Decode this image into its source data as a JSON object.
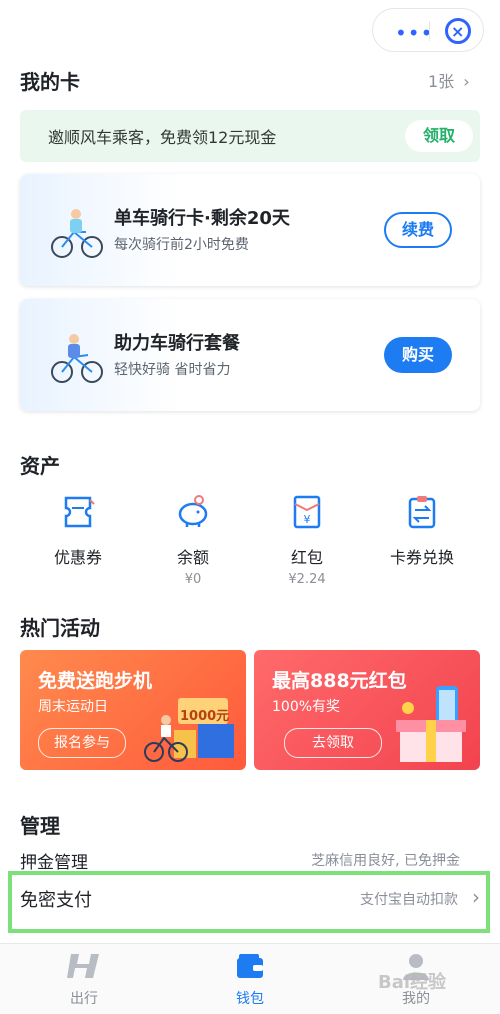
{
  "header": {
    "menu_icon": "more-dots-icon",
    "close_icon": "close-circle-icon"
  },
  "my_cards": {
    "title": "我的卡",
    "count": "1张"
  },
  "promo": {
    "text": "邀顺风车乘客，免费领12元现金",
    "button": "领取"
  },
  "cards": [
    {
      "title": "单车骑行卡·剩余20天",
      "subtitle": "每次骑行前2小时免费",
      "button": "续费"
    },
    {
      "title": "助力车骑行套餐",
      "subtitle": "轻快好骑 省时省力",
      "button": "购买"
    }
  ],
  "assets": {
    "title": "资产",
    "items": [
      {
        "label": "优惠券",
        "sub": ""
      },
      {
        "label": "余额",
        "sub": "¥0"
      },
      {
        "label": "红包",
        "sub": "¥2.24"
      },
      {
        "label": "卡券兑换",
        "sub": ""
      }
    ]
  },
  "hot": {
    "title": "热门活动",
    "items": [
      {
        "title": "免费送跑步机",
        "subtitle": "周末运动日",
        "button": "报名参与",
        "badge": "1000元"
      },
      {
        "title": "最高888元红包",
        "subtitle": "100%有奖",
        "button": "去领取"
      }
    ]
  },
  "manage": {
    "title": "管理",
    "rows": [
      {
        "label": "押金管理",
        "value": "芝麻信用良好, 已免押金"
      },
      {
        "label": "免密支付",
        "value": "支付宝自动扣款"
      }
    ]
  },
  "tabs": [
    {
      "label": "出行"
    },
    {
      "label": "钱包"
    },
    {
      "label": "我的"
    }
  ],
  "watermark": "Bai经验",
  "colors": {
    "accent": "#1d7cf2",
    "promo_green": "#23b06a",
    "highlight": "#7ee07a"
  }
}
